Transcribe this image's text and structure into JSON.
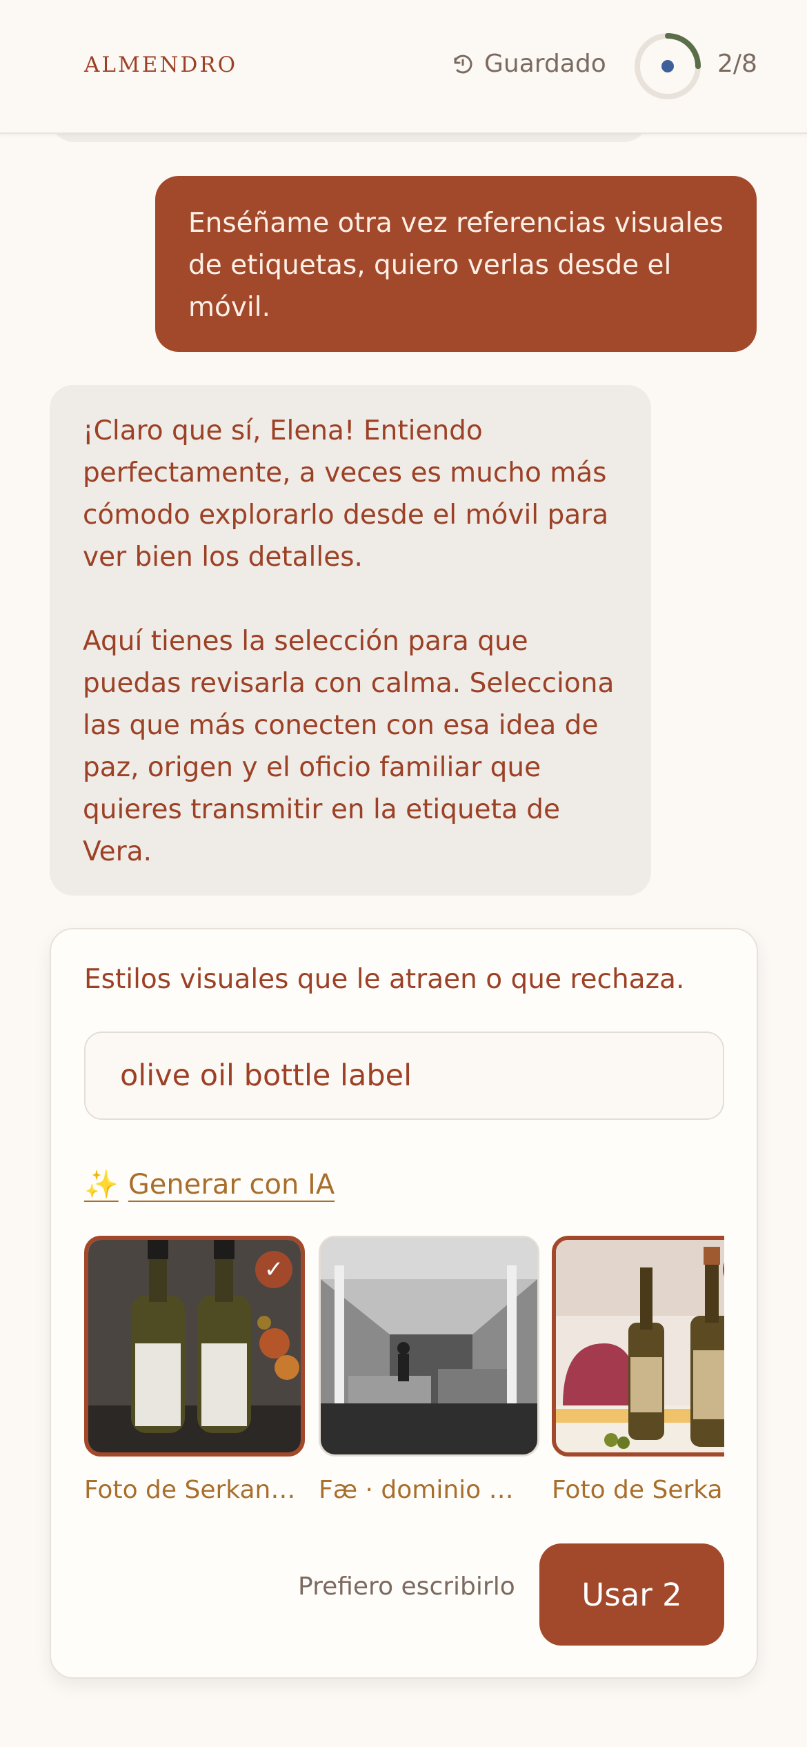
{
  "header": {
    "brand": "ALMENDRO",
    "saved_label": "Guardado",
    "step": "2/8",
    "progress": 0.25
  },
  "chat": {
    "user_message": "Enséñame otra vez referencias visuales de etiquetas, quiero verlas desde el móvil.",
    "assistant_paragraphs": [
      "¡Claro que sí, Elena! Entiendo perfectamente, a veces es mucho más cómodo explorarlo desde el móvil para ver bien los detalles.",
      "Aquí tienes la selección para que puedas revisarla con calma. Selecciona las que más conecten con esa idea de paz, origen y el oficio familiar que quieres transmitir en la etiqueta de Vera."
    ]
  },
  "card": {
    "title": "Estilos visuales que le atraen o que rechaza.",
    "search_value": "olive oil bottle label",
    "generate_label": "Generar con IA",
    "images": [
      {
        "caption": "Foto de Serkan Göktay · Pexels",
        "selected": true
      },
      {
        "caption": "Fæ · dominio público",
        "selected": false
      },
      {
        "caption": "Foto de Serkan Göktay · Pexels",
        "selected": true
      }
    ],
    "check_glyph": "✓",
    "prefer_label": "Prefiero escribirlo",
    "use_label": "Usar 2"
  },
  "colors": {
    "accent": "#a3492b",
    "background": "#fcf9f5",
    "link": "#a86e2c"
  }
}
